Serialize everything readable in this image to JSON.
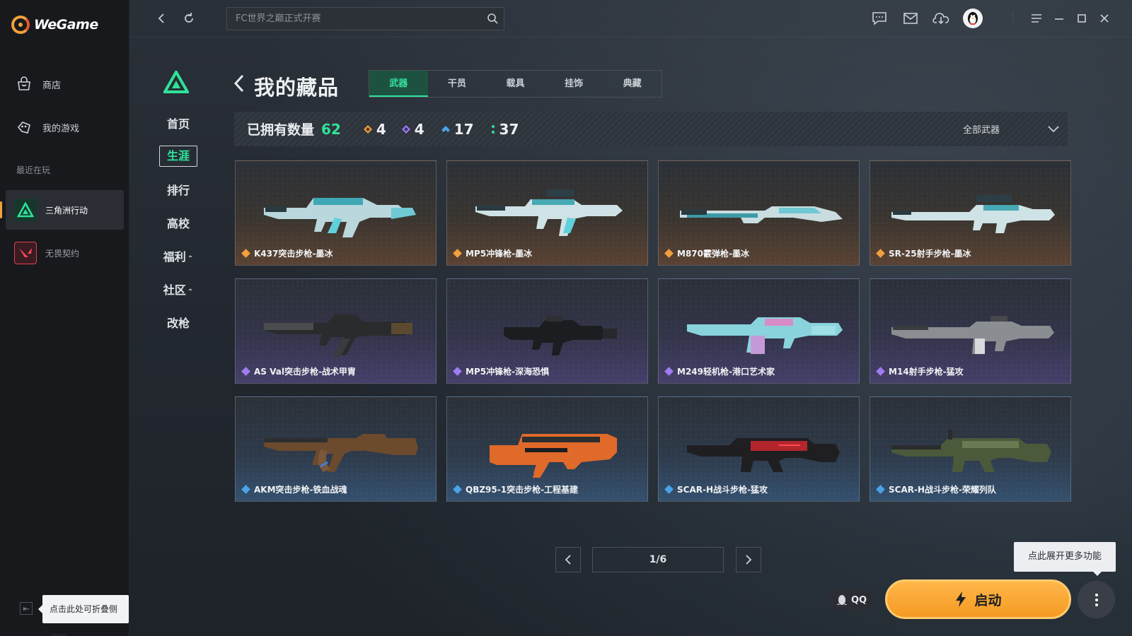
{
  "app": {
    "name": "WeGame"
  },
  "sidebar": {
    "nav": [
      {
        "label": "商店",
        "icon": "store-bag-icon"
      },
      {
        "label": "我的游戏",
        "icon": "controller-icon"
      }
    ],
    "recent_label": "最近在玩",
    "games": [
      {
        "label": "三角洲行动",
        "icon": "delta-force-icon",
        "active": true
      },
      {
        "label": "无畏契约",
        "icon": "valorant-icon",
        "active": false
      }
    ],
    "collapse_tip": "点击此处可折叠侧边栏"
  },
  "topbar": {
    "search_placeholder": "FC世界之巅正式开赛"
  },
  "game_nav": [
    {
      "label": "首页"
    },
    {
      "label": "生涯",
      "active": true
    },
    {
      "label": "排行"
    },
    {
      "label": "高校"
    },
    {
      "label": "福利",
      "caret": "⌃"
    },
    {
      "label": "社区",
      "caret": "⌃"
    },
    {
      "label": "改枪"
    }
  ],
  "page": {
    "title": "我的藏品",
    "tabs": [
      "武器",
      "干员",
      "载具",
      "挂饰",
      "典藏"
    ],
    "active_tab": "武器"
  },
  "stats": {
    "owned_label": "已拥有数量",
    "owned_count": "62",
    "rarities": [
      {
        "count": "4",
        "color": "#f0a03c"
      },
      {
        "count": "4",
        "color": "#9b7cf0"
      },
      {
        "count": "17",
        "color": "#4aa3e8"
      },
      {
        "count": "37",
        "color": "#2ee39a"
      }
    ],
    "filter_label": "全部武器"
  },
  "items": [
    {
      "name": "K437突击步枪-墨冰",
      "rarity": "gold",
      "rarity_color": "#f0a03c"
    },
    {
      "name": "MP5冲锋枪-墨冰",
      "rarity": "gold",
      "rarity_color": "#f0a03c"
    },
    {
      "name": "M870霰弹枪-墨冰",
      "rarity": "gold",
      "rarity_color": "#f0a03c"
    },
    {
      "name": "SR-25射手步枪-墨冰",
      "rarity": "gold",
      "rarity_color": "#f0a03c"
    },
    {
      "name": "AS Val突击步枪-战术甲胄",
      "rarity": "purple",
      "rarity_color": "#a07cf0"
    },
    {
      "name": "MP5冲锋枪-深海恐惧",
      "rarity": "purple",
      "rarity_color": "#a07cf0"
    },
    {
      "name": "M249轻机枪-港口艺术家",
      "rarity": "purple",
      "rarity_color": "#a07cf0"
    },
    {
      "name": "M14射手步枪-猛攻",
      "rarity": "purple",
      "rarity_color": "#a07cf0"
    },
    {
      "name": "AKM突击步枪-铁血战魂",
      "rarity": "blue",
      "rarity_color": "#4aa3e8"
    },
    {
      "name": "QBZ95-1突击步枪-工程基建",
      "rarity": "blue",
      "rarity_color": "#4aa3e8"
    },
    {
      "name": "SCAR-H战斗步枪-猛攻",
      "rarity": "blue",
      "rarity_color": "#4aa3e8"
    },
    {
      "name": "SCAR-H战斗步枪-荣耀列队",
      "rarity": "blue",
      "rarity_color": "#4aa3e8"
    }
  ],
  "pagination": {
    "info": "1/6"
  },
  "bottom": {
    "qq_label": "QQ",
    "launch_label": "启动",
    "more_tip": "点此展开更多功能"
  },
  "colors": {
    "accent": "#2ee39a",
    "launch": "#f7a12c"
  }
}
